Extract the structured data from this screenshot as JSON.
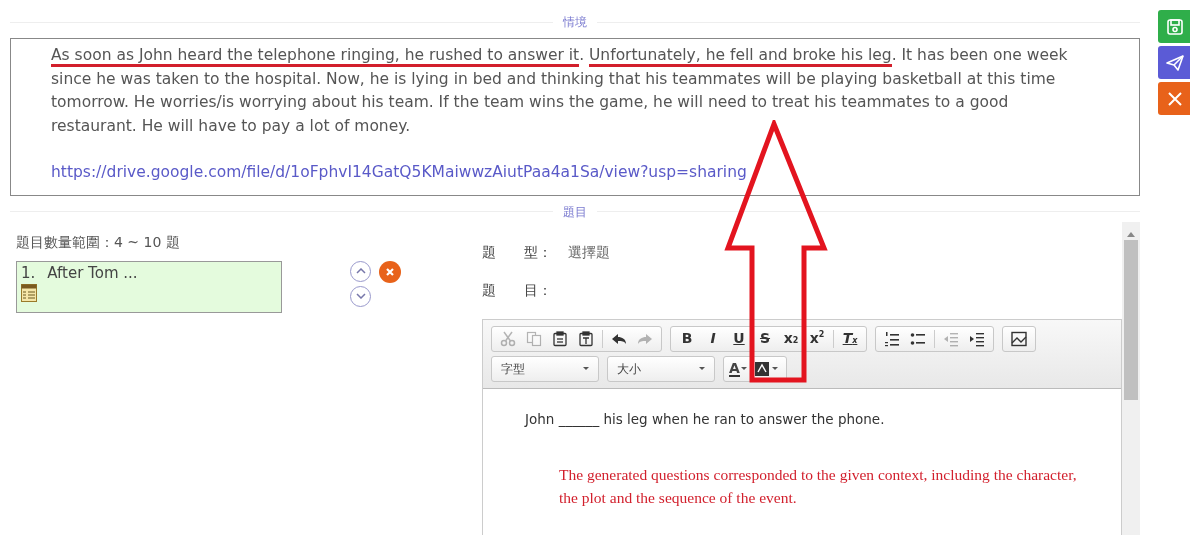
{
  "context_section": {
    "heading": "情境",
    "paragraph": [
      {
        "text": "As soon as John heard the telephone ringing, he rushed to answer it",
        "underlined": true
      },
      {
        "text": ". ",
        "underlined": false
      },
      {
        "text": "Unfortunately, he fell and broke his leg",
        "underlined": true
      },
      {
        "text": ". It has been one week since he was taken to the hospital. Now, he is lying in bed and thinking that his teammates will be playing basketball at this time tomorrow. He worries/is worrying  about his team. If the team wins the game, he will need  to treat his teammates to a good restaurant. He will have  to pay a lot of money.",
        "underlined": false
      }
    ],
    "link": "https://drive.google.com/file/d/1oFphvI14GatQ5KMaiwwzAiutPaa4a1Sa/view?usp=sharing"
  },
  "question_section": {
    "heading": "題目",
    "count_range": "題目數量範圍：4 ~ 10 題",
    "questions": [
      {
        "number": "1.",
        "text": "After Tom ...",
        "selected": true
      }
    ]
  },
  "detail": {
    "type_label": "題　　型：",
    "type_value": "選擇題",
    "question_label": "題　　目："
  },
  "editor": {
    "toolbar_rows": [
      [
        [
          {
            "kind": "cut",
            "disabled": true
          },
          {
            "kind": "copy",
            "disabled": true
          },
          {
            "kind": "paste",
            "disabled": false
          },
          {
            "kind": "paste-text",
            "disabled": false
          },
          {
            "kind": "sep"
          },
          {
            "kind": "undo",
            "disabled": false
          },
          {
            "kind": "redo",
            "disabled": true
          }
        ],
        [
          {
            "kind": "bold",
            "label": "B",
            "disabled": false
          },
          {
            "kind": "italic",
            "label": "I",
            "disabled": false
          },
          {
            "kind": "underline",
            "label": "U",
            "disabled": false
          },
          {
            "kind": "strike",
            "label": "S",
            "disabled": false
          },
          {
            "kind": "subscript",
            "label": "x$_{2}$",
            "disabled": false
          },
          {
            "kind": "superscript",
            "label": "x$^{2}$",
            "disabled": false
          },
          {
            "kind": "sep"
          },
          {
            "kind": "remove-format",
            "label": "T$_{x}$",
            "disabled": false
          }
        ],
        [
          {
            "kind": "numbered-list",
            "disabled": false
          },
          {
            "kind": "bulleted-list",
            "disabled": false
          },
          {
            "kind": "sep"
          },
          {
            "kind": "outdent",
            "disabled": true
          },
          {
            "kind": "indent",
            "disabled": false
          }
        ],
        [
          {
            "kind": "image",
            "disabled": false
          }
        ]
      ],
      [
        [
          {
            "kind": "dropdown",
            "label": "字型",
            "disabled": false
          }
        ],
        [
          {
            "kind": "dropdown",
            "label": "大小",
            "disabled": false
          }
        ],
        [
          {
            "kind": "text-color",
            "label": "A",
            "disabled": false
          },
          {
            "kind": "bg-color",
            "disabled": false
          }
        ]
      ]
    ],
    "content": "John ______ his leg when he ran to answer the phone."
  },
  "annotation": {
    "note": "The generated questions corresponded to the given context, including the character, the plot and the sequence of the event."
  },
  "side_buttons": [
    {
      "kind": "save"
    },
    {
      "kind": "send"
    },
    {
      "kind": "close"
    }
  ]
}
